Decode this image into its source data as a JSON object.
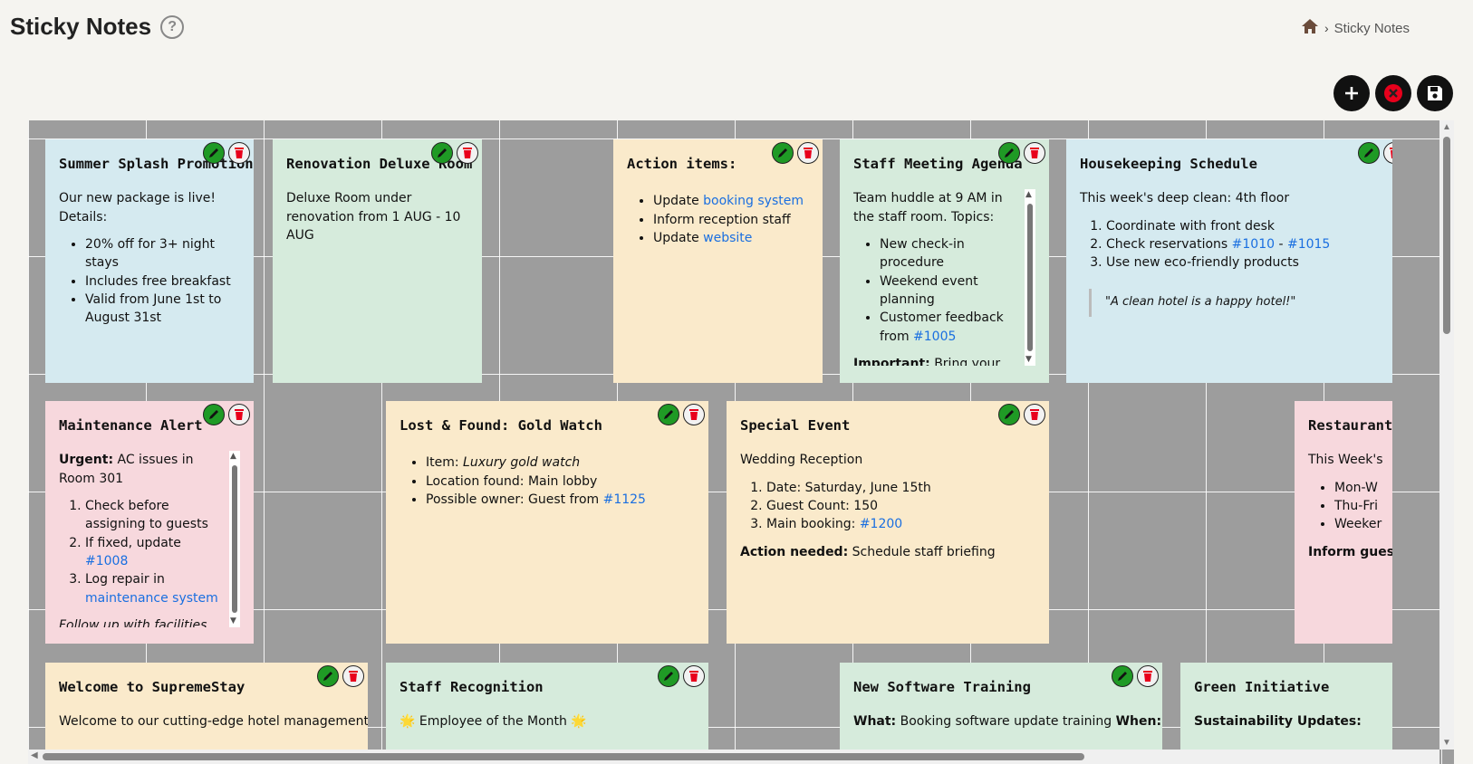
{
  "header": {
    "title": "Sticky Notes",
    "breadcrumb_current": "Sticky Notes"
  },
  "icons": {
    "help": "question-circle-icon",
    "home": "home-icon",
    "add": "plus-icon",
    "clear": "close-circle-icon",
    "save": "floppy-disk-icon",
    "edit": "pencil-icon",
    "delete": "trash-icon"
  },
  "colors": {
    "blue": "#d5eaf0",
    "green": "#d6ebdc",
    "orange": "#faeacb",
    "pink": "#f7d8dd",
    "link": "#1a6fe0",
    "edit_button": "#1f9a25",
    "delete_icon": "#e8001c"
  },
  "notes": {
    "summer": {
      "title": "Summer Splash Promotion",
      "intro": "Our new package is live! Details:",
      "items": [
        "20% off for 3+ night stays",
        "Includes free breakfast",
        "Valid from June 1st to August 31st"
      ]
    },
    "renovation": {
      "title": "Renovation Deluxe Room",
      "text": "Deluxe Room under renovation from 1 AUG - 10 AUG"
    },
    "action": {
      "title": "Action items:",
      "item1_pre": "Update ",
      "item1_link": "booking system",
      "item2": "Inform reception staff",
      "item3_pre": "Update ",
      "item3_link": "website"
    },
    "staff_meeting": {
      "title": "Staff Meeting Agenda",
      "intro": "Team huddle at 9 AM in the staff room. Topics:",
      "items": [
        "New check-in procedure",
        "Weekend event planning"
      ],
      "item3_pre": "Customer feedback from ",
      "item3_link": "#1005",
      "important_label": "Important:",
      "important_text": " Bring your tablets for interactive session"
    },
    "housekeeping": {
      "title": "Housekeeping Schedule",
      "intro": "This week's deep clean: 4th floor",
      "item1": "Coordinate with front desk",
      "item2_pre": "Check reservations ",
      "item2_link1": "#1010",
      "item2_sep": " - ",
      "item2_link2": "#1015",
      "item3": "Use new eco-friendly products",
      "quote": "\"A clean hotel is a happy hotel!\""
    },
    "maintenance": {
      "title": "Maintenance Alert",
      "urgent_label": "Urgent:",
      "urgent_text": " AC issues in Room 301",
      "item1": "Check before assigning to guests",
      "item2_pre": "If fixed, update ",
      "item2_link": "#1008",
      "item3_pre": "Log repair in ",
      "item3_link": "maintenance system",
      "followup": "Follow up with facilities team ASAP"
    },
    "lost_found": {
      "title": "Lost & Found: Gold Watch",
      "item1_pre": "Item: ",
      "item1_em": "Luxury gold watch",
      "item2": "Location found: Main lobby",
      "item3_pre": "Possible owner: Guest from ",
      "item3_link": "#1125"
    },
    "special_event": {
      "title": "Special Event",
      "intro": "Wedding Reception",
      "items": [
        "Date: Saturday, June 15th",
        "Guest Count: 150"
      ],
      "item3_pre": "Main booking: ",
      "item3_link": "#1200",
      "action_label": "Action needed:",
      "action_text": " Schedule staff briefing"
    },
    "restaurant": {
      "title": "Restaurant",
      "intro": "This Week's",
      "items": [
        "Mon-W",
        "Thu-Fri",
        "Weeker"
      ],
      "inform": "Inform gues"
    },
    "welcome": {
      "title": "Welcome to SupremeStay",
      "text": "Welcome to our cutting-edge hotel management"
    },
    "recognition": {
      "title": "Staff Recognition",
      "text": "🌟 Employee of the Month 🌟"
    },
    "training": {
      "title": "New Software Training",
      "what_label": "What:",
      "what_text": " Booking software update training ",
      "when_label": "When:"
    },
    "green_initiative": {
      "title": "Green Initiative",
      "label": "Sustainability Updates:"
    }
  }
}
